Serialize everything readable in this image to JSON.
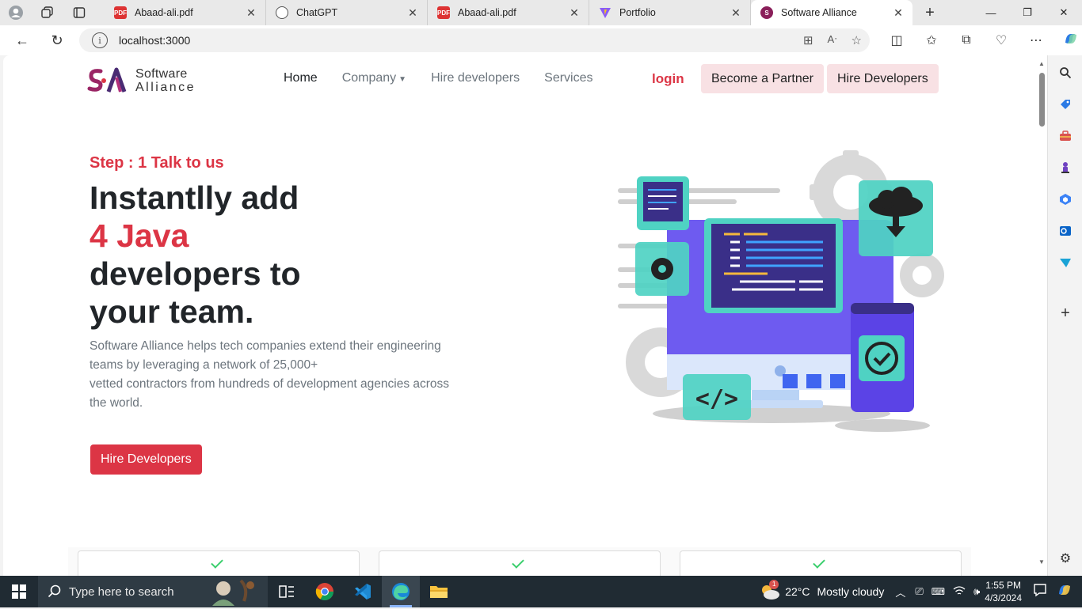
{
  "browser": {
    "tabs": [
      {
        "title": "Abaad-ali.pdf",
        "icon": "pdf-icon"
      },
      {
        "title": "ChatGPT",
        "icon": "chatgpt-icon"
      },
      {
        "title": "Abaad-ali.pdf",
        "icon": "pdf-icon"
      },
      {
        "title": "Portfolio",
        "icon": "vite-icon"
      },
      {
        "title": "Software Alliance",
        "icon": "software-alliance-icon",
        "active": true
      }
    ],
    "url": "localhost:3000"
  },
  "site": {
    "logo": {
      "line1": "Software",
      "line2": "Alliance"
    },
    "nav": {
      "home": "Home",
      "company": "Company",
      "hire": "Hire developers",
      "services": "Services"
    },
    "login": "login",
    "become_partner": "Become a Partner",
    "hire_developers": "Hire Developers"
  },
  "hero": {
    "step": "Step : 1 Talk to us",
    "line1": "Instantlly add",
    "line2": "4 Java",
    "line3": "developers to",
    "line4": "your team.",
    "desc1": "Software Alliance helps tech companies extend their engineering teams by leveraging a network of 25,000+",
    "desc2": "vetted contractors from hundreds of development agencies across the world.",
    "cta": "Hire Developers"
  },
  "taskbar": {
    "search_placeholder": "Type here to search",
    "weather_temp": "22°C",
    "weather_text": "Mostly cloudy",
    "weather_badge": "1",
    "time": "1:55 PM",
    "date": "4/3/2024"
  },
  "colors": {
    "accent": "#dc3545",
    "pill_bg": "#f8e1e4",
    "taskbar": "#202b33"
  }
}
